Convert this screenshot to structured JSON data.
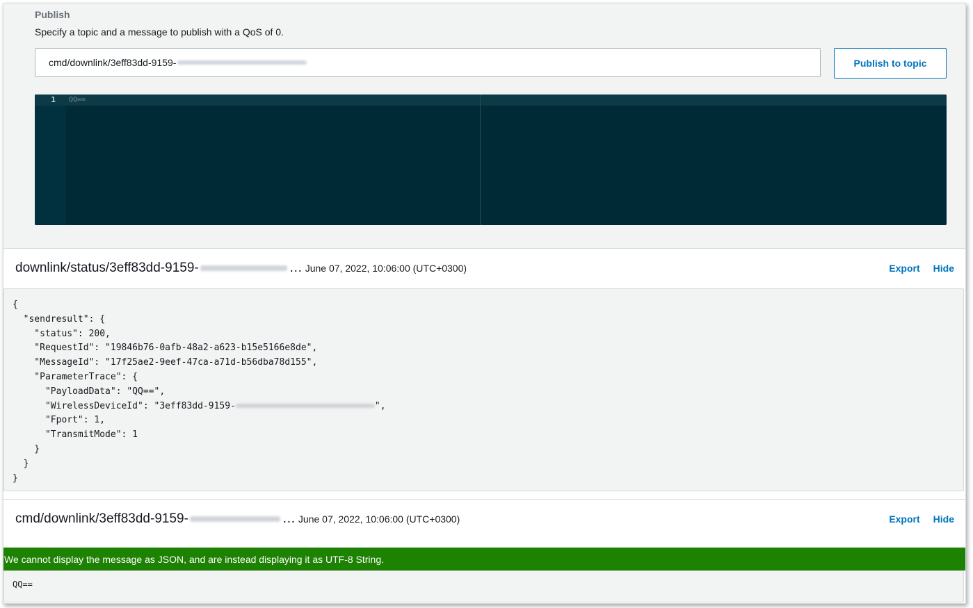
{
  "publish": {
    "title": "Publish",
    "description": "Specify a topic and a message to publish with a QoS of 0.",
    "topic_value": "cmd/downlink/3eff83dd-9159-",
    "publish_button": "Publish to topic",
    "editor": {
      "line_number": "1",
      "code": "QQ=="
    }
  },
  "messages": [
    {
      "topic": "downlink/status/3eff83dd-9159-",
      "ellipsis": "…",
      "timestamp": "June 07, 2022, 10:06:00 (UTC+0300)",
      "export_label": "Export",
      "hide_label": "Hide",
      "payload_lines": [
        "{",
        "  \"sendresult\": {",
        "    \"status\": 200,",
        "    \"RequestId\": \"19846b76-0afb-48a2-a623-b15e5166e8de\",",
        "    \"MessageId\": \"17f25ae2-9eef-47ca-a71d-b56dba78d155\",",
        "    \"ParameterTrace\": {",
        "      \"PayloadData\": \"QQ==\",",
        "      \"WirelessDeviceId\": \"3eff83dd-9159-",
        "      \"Fport\": 1,",
        "      \"TransmitMode\": 1",
        "    }",
        "  }",
        "}"
      ],
      "wireless_suffix": "\","
    },
    {
      "topic": "cmd/downlink/3eff83dd-9159-",
      "ellipsis": "…",
      "timestamp": "June 07, 2022, 10:06:00 (UTC+0300)",
      "export_label": "Export",
      "hide_label": "Hide",
      "notice": "We cannot display the message as JSON, and are instead displaying it as UTF-8 String.",
      "payload": "QQ=="
    }
  ],
  "colors": {
    "accent": "#0073bb",
    "success_banner": "#1d8102",
    "editor_bg": "#002b36"
  }
}
